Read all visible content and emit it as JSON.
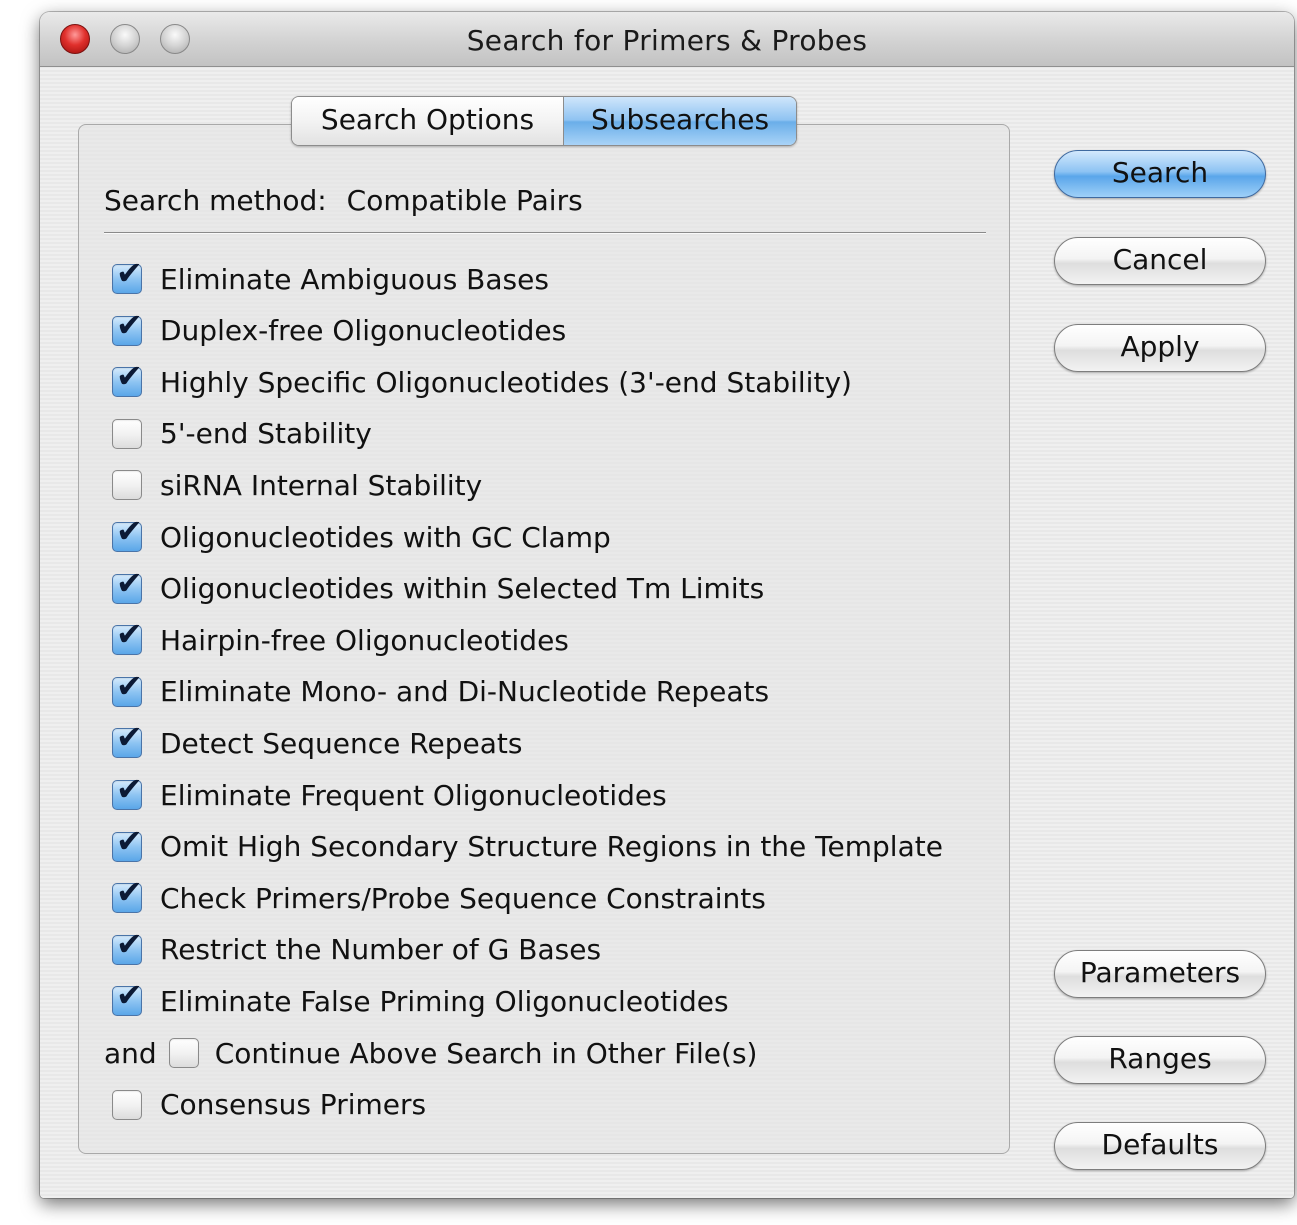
{
  "window": {
    "title": "Search for Primers & Probes"
  },
  "tabs": [
    {
      "label": "Search Options",
      "selected": false
    },
    {
      "label": "Subsearches",
      "selected": true
    }
  ],
  "search_method": {
    "label": "Search method:",
    "value": "Compatible Pairs"
  },
  "options": [
    {
      "label": "Eliminate Ambiguous Bases",
      "checked": true
    },
    {
      "label": "Duplex-free Oligonucleotides",
      "checked": true
    },
    {
      "label": "Highly Specific Oligonucleotides (3'-end Stability)",
      "checked": true
    },
    {
      "label": "5'-end Stability",
      "checked": false
    },
    {
      "label": "siRNA Internal Stability",
      "checked": false
    },
    {
      "label": "Oligonucleotides with GC Clamp",
      "checked": true
    },
    {
      "label": "Oligonucleotides within Selected Tm Limits",
      "checked": true
    },
    {
      "label": "Hairpin-free Oligonucleotides",
      "checked": true
    },
    {
      "label": "Eliminate Mono- and Di-Nucleotide Repeats",
      "checked": true
    },
    {
      "label": "Detect Sequence Repeats",
      "checked": true
    },
    {
      "label": "Eliminate Frequent Oligonucleotides",
      "checked": true
    },
    {
      "label": "Omit High Secondary Structure Regions in the Template",
      "checked": true
    },
    {
      "label": "Check Primers/Probe Sequence Constraints",
      "checked": true
    },
    {
      "label": "Restrict the Number of G Bases",
      "checked": true
    },
    {
      "label": "Eliminate False Priming Oligonucleotides",
      "checked": true
    }
  ],
  "continue_option": {
    "prefix": "and",
    "label": "Continue Above Search in Other File(s)",
    "checked": false
  },
  "consensus_option": {
    "label": "Consensus Primers",
    "checked": false
  },
  "buttons": {
    "search": "Search",
    "cancel": "Cancel",
    "apply": "Apply",
    "parameters": "Parameters",
    "ranges": "Ranges",
    "defaults": "Defaults"
  },
  "colors": {
    "accent": "#6aaee9",
    "close_button": "#e0302c"
  },
  "icons": {
    "check": "checkmark-icon"
  }
}
